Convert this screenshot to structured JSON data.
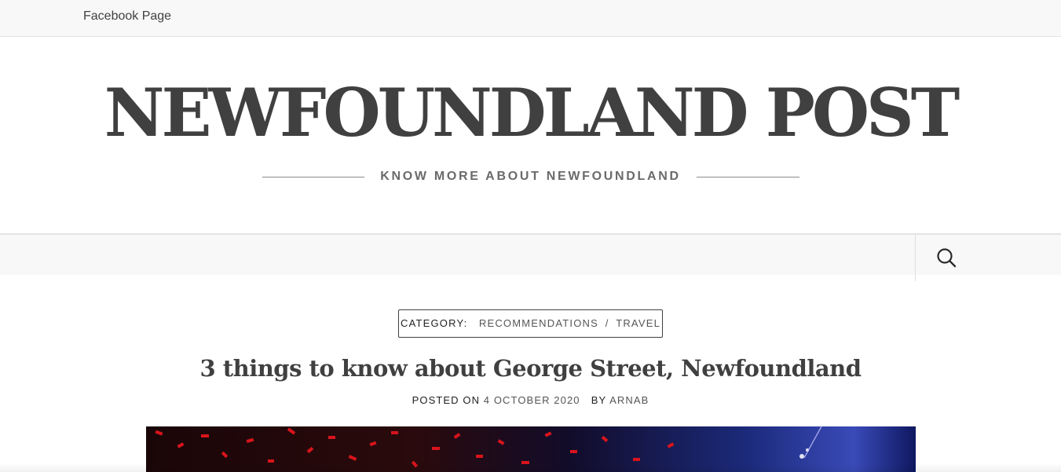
{
  "topbar": {
    "link": "Facebook Page"
  },
  "header": {
    "site_title": "NEWFOUNDLAND POST",
    "tagline": "KNOW MORE ABOUT NEWFOUNDLAND"
  },
  "nav": {
    "search_icon": "search-icon"
  },
  "post": {
    "category_label": "CATEGORY:",
    "categories": [
      "RECOMMENDATIONS",
      "TRAVEL"
    ],
    "category_separator": "/",
    "title": "3 things to know about George Street, Newfoundland",
    "posted_on_label": "POSTED ON",
    "date": "4 OCTOBER 2020",
    "by_label": "BY",
    "author": "ARNAB"
  },
  "colors": {
    "text": "#404040",
    "bar_background": "#f8f8f9"
  }
}
